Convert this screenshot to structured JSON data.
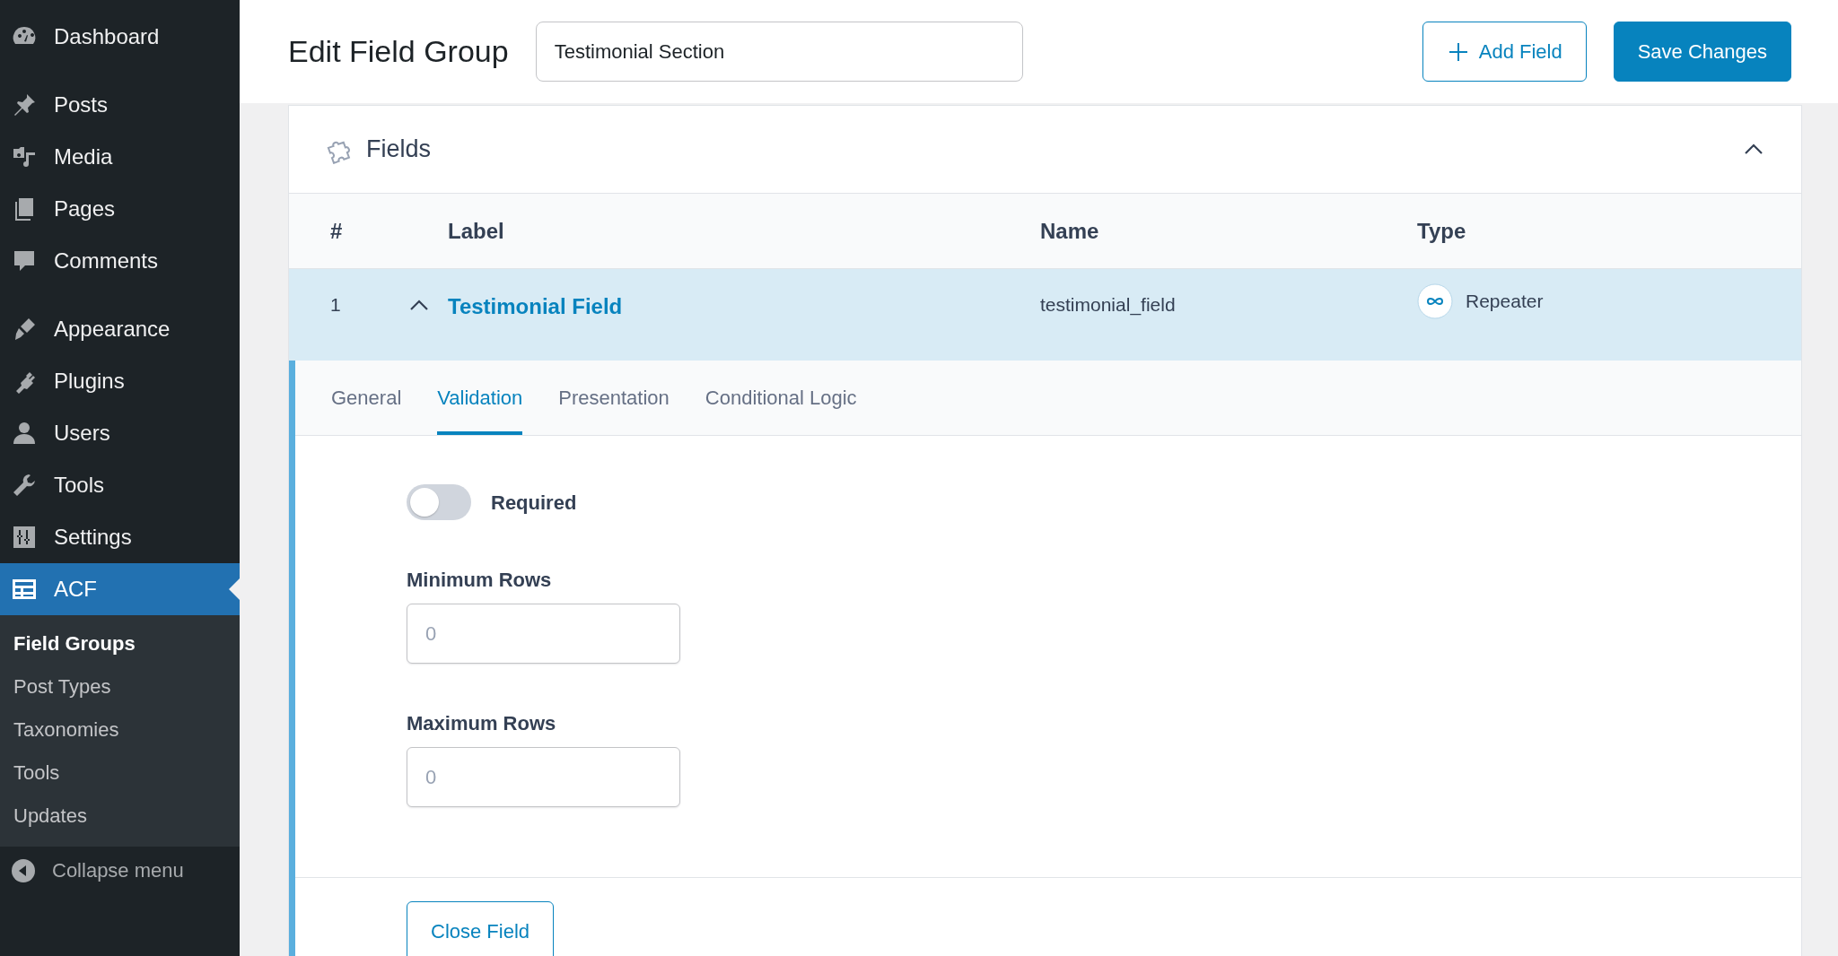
{
  "sidebar": {
    "groups": [
      [
        {
          "label": "Dashboard",
          "selected": false
        }
      ],
      [
        {
          "label": "Posts",
          "selected": false
        },
        {
          "label": "Media",
          "selected": false
        },
        {
          "label": "Pages",
          "selected": false
        },
        {
          "label": "Comments",
          "selected": false
        }
      ],
      [
        {
          "label": "Appearance",
          "selected": false
        },
        {
          "label": "Plugins",
          "selected": false
        },
        {
          "label": "Users",
          "selected": false
        },
        {
          "label": "Tools",
          "selected": false
        },
        {
          "label": "Settings",
          "selected": false
        },
        {
          "label": "ACF",
          "selected": true
        }
      ]
    ],
    "submenu": [
      {
        "label": "Field Groups",
        "selected": true
      },
      {
        "label": "Post Types",
        "selected": false
      },
      {
        "label": "Taxonomies",
        "selected": false
      },
      {
        "label": "Tools",
        "selected": false
      },
      {
        "label": "Updates",
        "selected": false
      }
    ],
    "collapse": "Collapse menu"
  },
  "header": {
    "title": "Edit Field Group",
    "group_name": "Testimonial Section",
    "buttons": [
      {
        "label": "Add Field",
        "kind": "outline"
      },
      {
        "label": "Save Changes",
        "kind": "primary"
      }
    ]
  },
  "panel": {
    "title": "Fields",
    "expanded": true,
    "columns": [
      "#",
      "Label",
      "Name",
      "Type"
    ],
    "fields": [
      {
        "number": "1",
        "label": "Testimonial Field",
        "name": "testimonial_field",
        "type": "Repeater",
        "expanded": true,
        "tabs": [
          {
            "label": "General",
            "selected": false
          },
          {
            "label": "Validation",
            "selected": true
          },
          {
            "label": "Presentation",
            "selected": false
          },
          {
            "label": "Conditional Logic",
            "selected": false
          }
        ],
        "settings": [
          {
            "kind": "toggle",
            "label": "Required",
            "on": false
          },
          {
            "kind": "number",
            "label": "Minimum Rows",
            "placeholder": "0"
          },
          {
            "kind": "number",
            "label": "Maximum Rows",
            "placeholder": "0"
          }
        ],
        "close_button": "Close Field"
      }
    ]
  }
}
